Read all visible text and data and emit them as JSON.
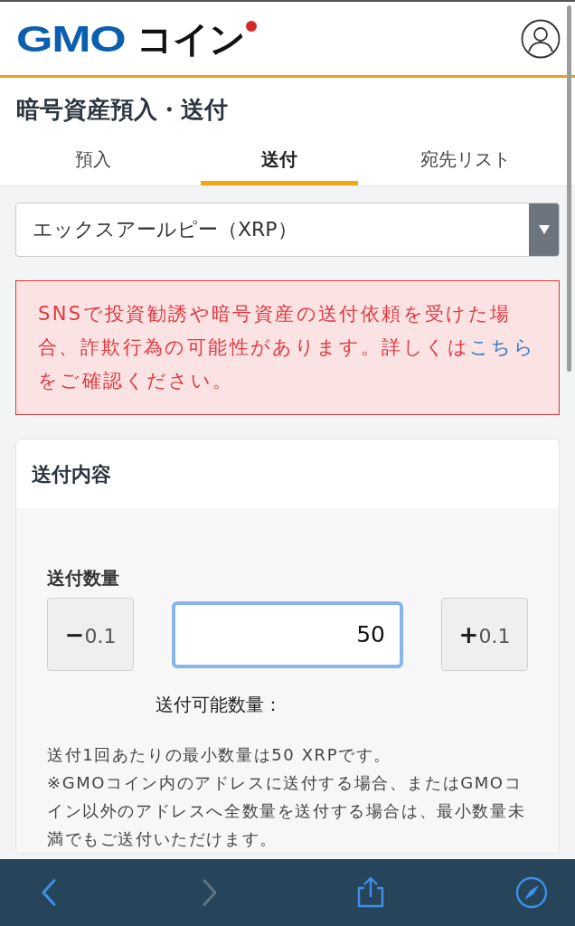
{
  "header": {
    "logo": {
      "brand": "GMO",
      "product": "コイン"
    }
  },
  "page_title": "暗号資産預入・送付",
  "tabs": [
    {
      "label": "預入",
      "selected": false
    },
    {
      "label": "送付",
      "selected": true
    },
    {
      "label": "宛先リスト",
      "selected": false
    }
  ],
  "currency_select": {
    "value": "エックスアールピー（XRP）"
  },
  "warning": {
    "text_before": "SNSで投資勧誘や暗号資産の送付依頼を受けた場合、詐欺行為の可能性があります。詳しくは",
    "link": "こちら",
    "text_after": "をご確認ください。"
  },
  "send_card": {
    "title": "送付内容",
    "amount_label": "送付数量",
    "decrement": {
      "sign": "−",
      "step": "0.1"
    },
    "amount_value": "50",
    "increment": {
      "sign": "+",
      "step": "0.1"
    },
    "available_label": "送付可能数量：",
    "notes": [
      "送付1回あたりの最小数量は50 XRPです。",
      "※GMOコイン内のアドレスに送付する場合、またはGMOコイン以外のアドレスへ全数量を送付する場合は、最小数量未満でもご送付いただけます。"
    ]
  },
  "browser_toolbar": {
    "buttons": [
      {
        "kind": "back",
        "disabled": false
      },
      {
        "kind": "forward",
        "disabled": true
      },
      {
        "kind": "share",
        "disabled": false
      },
      {
        "kind": "compass",
        "disabled": false
      }
    ]
  }
}
